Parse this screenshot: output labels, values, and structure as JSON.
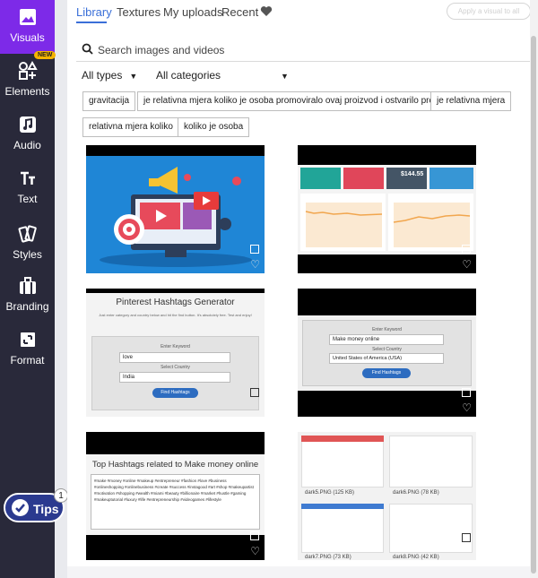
{
  "sidebar": {
    "items": [
      {
        "label": "Visuals",
        "icon": "image-icon"
      },
      {
        "label": "Elements",
        "icon": "shapes-icon",
        "badge": "NEW"
      },
      {
        "label": "Audio",
        "icon": "music-note-icon"
      },
      {
        "label": "Text",
        "icon": "text-icon"
      },
      {
        "label": "Styles",
        "icon": "swatch-icon"
      },
      {
        "label": "Branding",
        "icon": "briefcase-icon"
      },
      {
        "label": "Format",
        "icon": "resize-icon"
      }
    ],
    "tips": {
      "label": "Tips",
      "count": "1"
    }
  },
  "tabs": [
    "Library",
    "Textures",
    "My uploads",
    "Recent"
  ],
  "apply_button": "Apply a visual to all",
  "search": {
    "placeholder": "Search images and videos"
  },
  "filters": {
    "type": "All types",
    "category": "All categories"
  },
  "chips": [
    "gravitacija",
    "je relativna mjera koliko je osoba promoviralo ovaj proizvod i ostvarilo prodaju",
    "je relativna mjera",
    "relativna mjera koliko",
    "koliko je osoba"
  ],
  "thumbnails": {
    "t2": {
      "stats": [
        "$144.55"
      ]
    },
    "t3": {
      "title": "Pinterest Hashtags Generator",
      "subtitle": "Just enter category and country below and hit the find button. It's absolutely free. Test and enjoy!",
      "keyword_label": "Enter Keyword",
      "keyword_value": "love",
      "country_label": "Select Country",
      "country_value": "India",
      "button": "Find Hashtags"
    },
    "t4": {
      "keyword_label": "Enter Keyword",
      "keyword_value": "Make money online",
      "country_label": "Select Country",
      "country_value": "United States of America (USA)",
      "button": "Find Hashtags"
    },
    "t5": {
      "title": "Top Hashtags related to Make money online",
      "body": "#make #money #online #makeup #entrepreneur #fashion #love #business #onlineshopping #onlinebusiness #create #success #instagood #art #shop #makeupartist #motivation #shopping #wealth #miami #beauty #billionaire #market #hustle #gaming #makeuptutorial #luxury #life #entrepreneurship #videogames #lifestyle"
    },
    "t6": {
      "files": [
        "dark5.PNG (125 KB)",
        "dark6.PNG (78 KB)",
        "dark7.PNG (73 KB)",
        "dark8.PNG (42 KB)"
      ]
    }
  },
  "colors": {
    "accent": "#7d2ae8",
    "sidebar": "#29293a",
    "link": "#3a6fd8"
  }
}
